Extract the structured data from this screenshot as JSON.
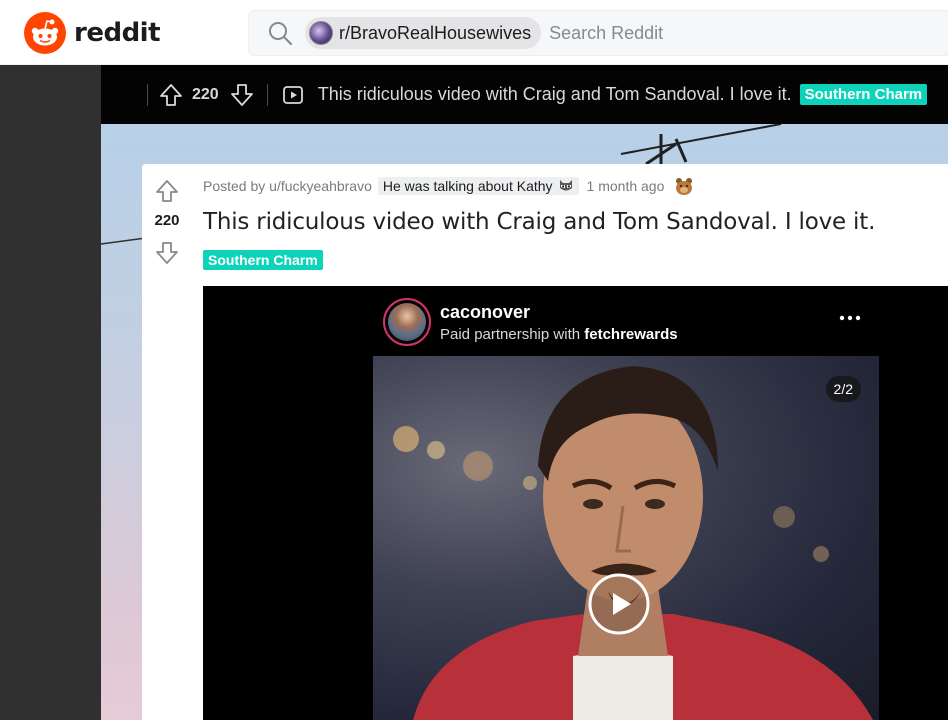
{
  "header": {
    "logo_text": "reddit",
    "search": {
      "subreddit_chip": "r/BravoRealHousewives",
      "placeholder": "Search Reddit"
    }
  },
  "sticky_bar": {
    "score": "220",
    "title": "This ridiculous video with Craig and Tom Sandoval. I love it.",
    "flair": "Southern Charm"
  },
  "post": {
    "score": "220",
    "posted_by": "Posted by u/fuckyeahbravo",
    "user_flair": "He was talking about Kathy",
    "time": "1 month ago",
    "title": "This ridiculous video with Craig and Tom Sandoval. I love it.",
    "flair": "Southern Charm",
    "video": {
      "account": "caconover",
      "subtitle_prefix": "Paid partnership with ",
      "subtitle_brand": "fetchrewards",
      "counter": "2/2"
    }
  },
  "colors": {
    "brand": "#ff4500",
    "flair": "#0dd3bb",
    "sticky_bar": "#030303",
    "gutter": "#303030"
  },
  "icons": [
    "reddit-logo-icon",
    "search-icon",
    "upvote-icon",
    "downvote-icon",
    "video-post-icon",
    "raccoon-icon",
    "award-icon",
    "more-options-icon",
    "play-icon"
  ]
}
